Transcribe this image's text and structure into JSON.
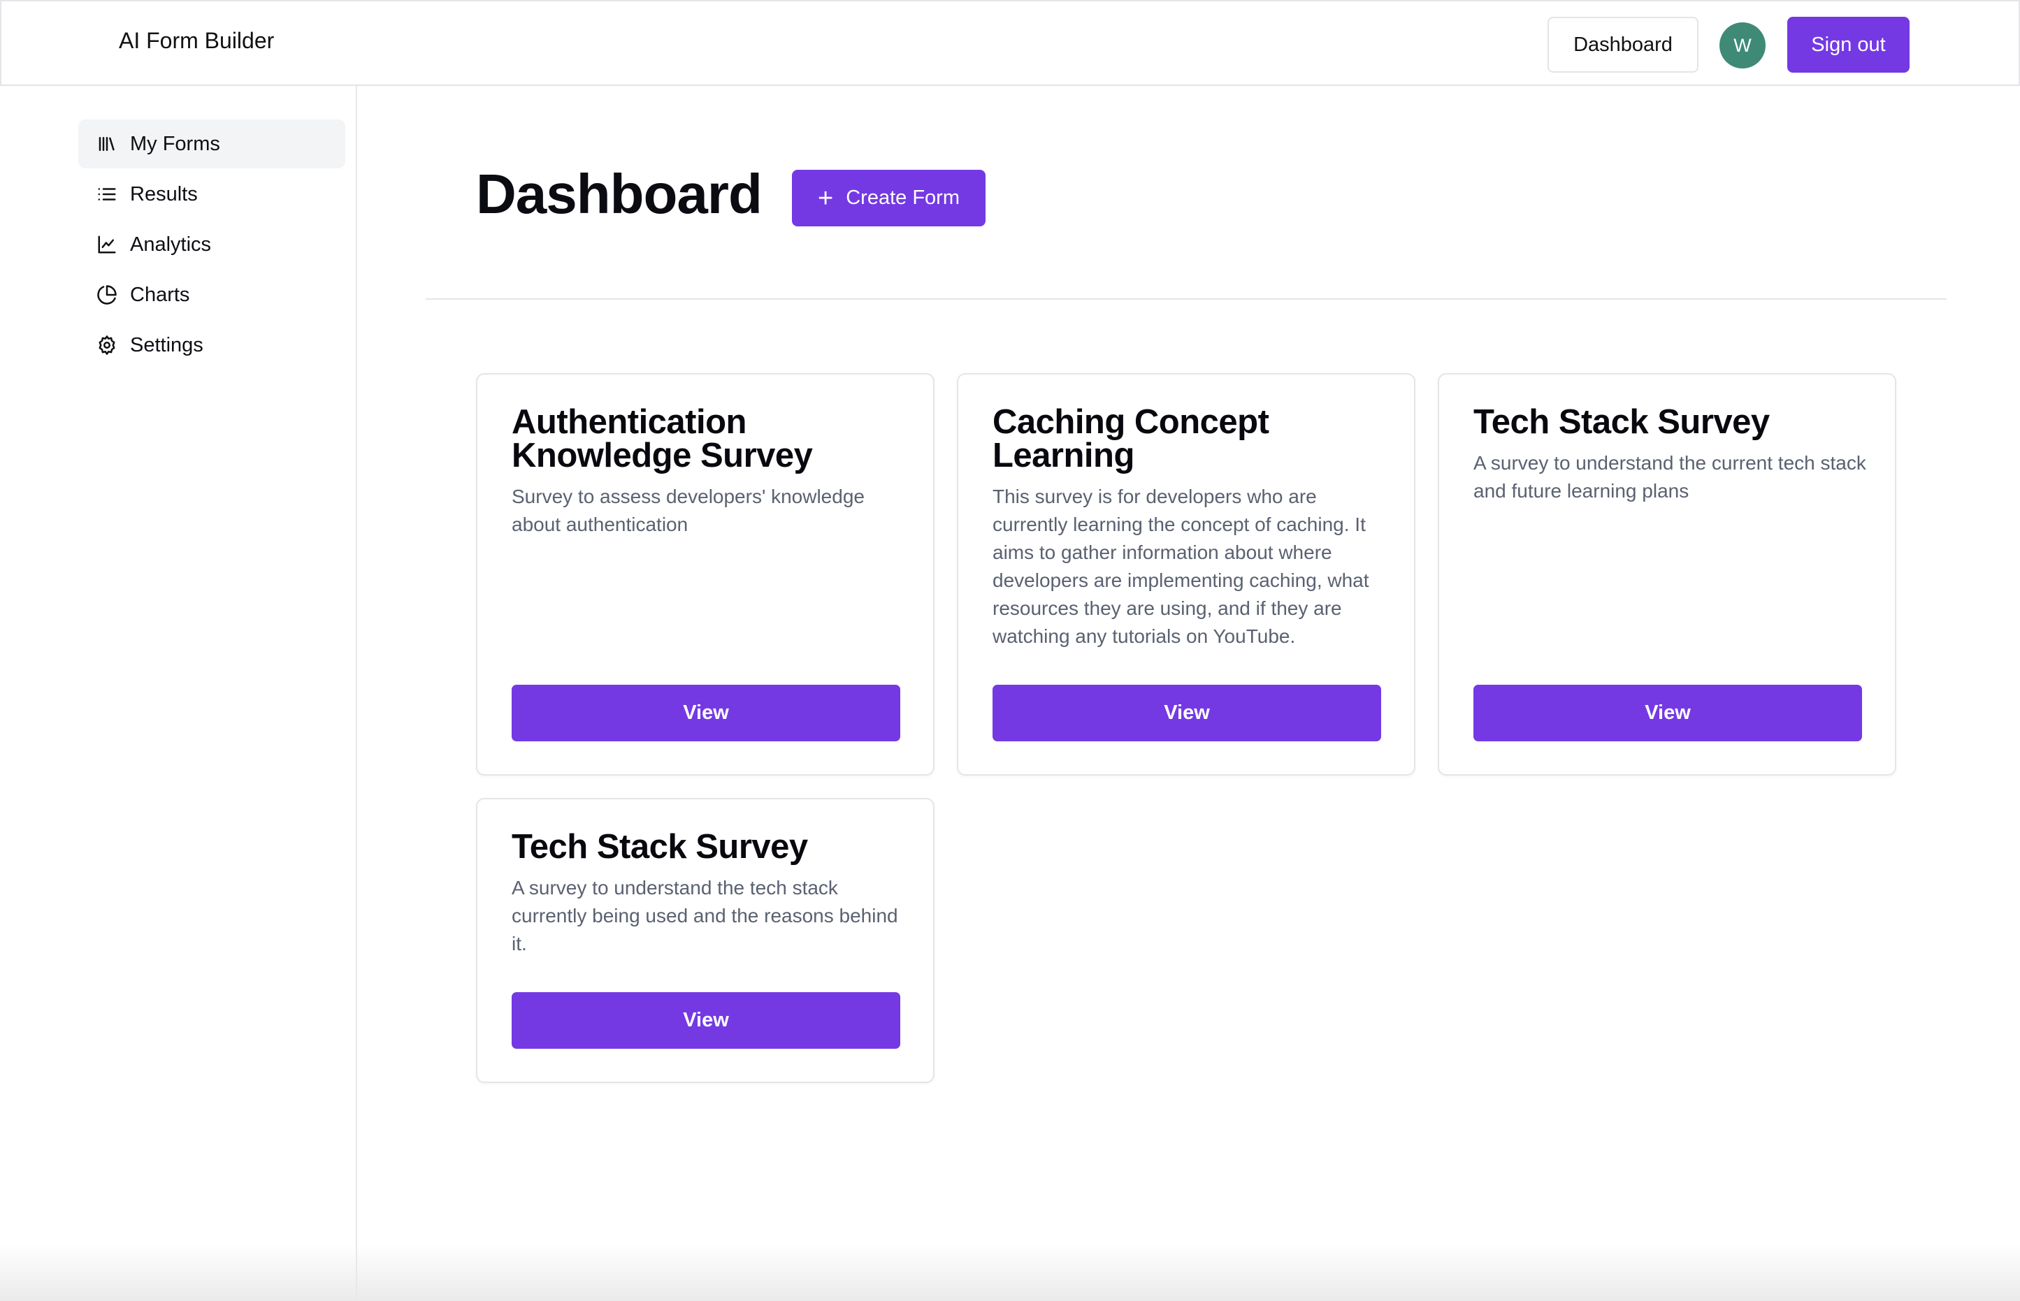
{
  "header": {
    "brand": "AI Form Builder",
    "dashboard_label": "Dashboard",
    "avatar_initial": "W",
    "sign_out_label": "Sign out"
  },
  "sidebar": {
    "items": [
      {
        "label": "My Forms",
        "icon": "library-icon",
        "active": true
      },
      {
        "label": "Results",
        "icon": "list-icon",
        "active": false
      },
      {
        "label": "Analytics",
        "icon": "line-chart-icon",
        "active": false
      },
      {
        "label": "Charts",
        "icon": "pie-chart-icon",
        "active": false
      },
      {
        "label": "Settings",
        "icon": "gear-icon",
        "active": false
      }
    ]
  },
  "main": {
    "title": "Dashboard",
    "create_label": "Create Form",
    "cards": [
      {
        "title": "Authentication Knowledge Survey",
        "description": "Survey to assess developers' knowledge about authentication",
        "button": "View"
      },
      {
        "title": "Caching Concept Learning",
        "description": "This survey is for developers who are currently learning the concept of caching. It aims to gather information about where developers are implementing caching, what resources they are using, and if they are watching any tutorials on YouTube.",
        "button": "View"
      },
      {
        "title": "Tech Stack Survey",
        "description": "A survey to understand the current tech stack and future learning plans",
        "button": "View"
      },
      {
        "title": "Tech Stack Survey",
        "description": "A survey to understand the tech stack currently being used and the reasons behind it.",
        "button": "View"
      }
    ]
  },
  "colors": {
    "accent": "#7439e3",
    "avatar": "#3e8a77"
  }
}
